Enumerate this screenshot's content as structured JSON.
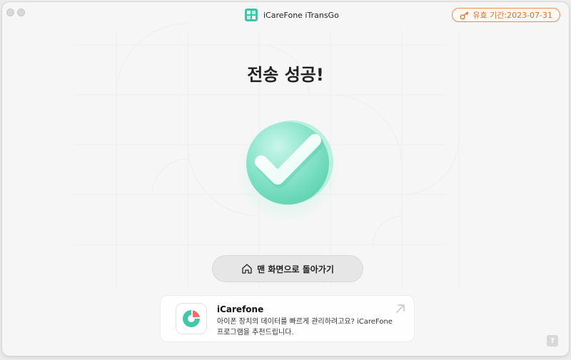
{
  "window": {
    "title": "iCareFone iTransGo",
    "license_badge": "유효 기간:2023-07-31"
  },
  "main": {
    "headline": "전송 성공!",
    "home_button_label": "맨 화면으로 돌아가기"
  },
  "promo": {
    "title": "iCarefone",
    "description": "아이폰 장치의 데이터를 빠르게 관리하려고요? iCareFone 프로그램을 추천드립니다."
  },
  "help": {
    "label": "?"
  },
  "icons": [
    "app-logo-icon",
    "key-icon",
    "checkmark-icon",
    "home-icon",
    "icarefone-logo-icon",
    "external-arrow-icon",
    "help-icon"
  ],
  "colors": {
    "accent_orange": "#ee6a1e",
    "success_green": "#7fe0c3",
    "check_white": "#ffffff"
  }
}
